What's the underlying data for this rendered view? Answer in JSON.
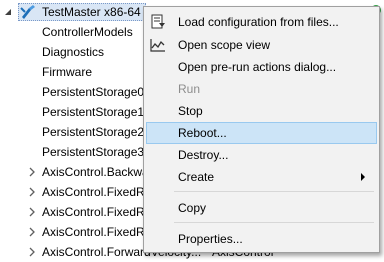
{
  "tree": {
    "root_label": "TestMaster x86-64",
    "items": [
      {
        "label": "ControllerModels",
        "expandable": false
      },
      {
        "label": "Diagnostics",
        "expandable": false
      },
      {
        "label": "Firmware",
        "expandable": false
      },
      {
        "label": "PersistentStorage0",
        "expandable": false
      },
      {
        "label": "PersistentStorage1",
        "expandable": false
      },
      {
        "label": "PersistentStorage2",
        "expandable": false
      },
      {
        "label": "PersistentStorage3",
        "expandable": false
      },
      {
        "label": "AxisControl.Backwa",
        "expandable": true
      },
      {
        "label": "AxisControl.FixedR",
        "expandable": true
      },
      {
        "label": "AxisControl.FixedR",
        "expandable": true
      },
      {
        "label": "AxisControl.FixedR",
        "expandable": true
      },
      {
        "label": "AxisControl.ForwardVelocity...",
        "expandable": true,
        "type": "AxisControl"
      }
    ]
  },
  "context_menu": {
    "items": [
      {
        "label": "Load configuration from files...",
        "icon": "load-config-icon",
        "enabled": true
      },
      {
        "label": "Open scope view",
        "icon": "scope-view-icon",
        "enabled": true
      },
      {
        "label": "Open pre-run actions dialog...",
        "enabled": true
      },
      {
        "label": "Run",
        "enabled": false
      },
      {
        "label": "Stop",
        "enabled": true
      },
      {
        "label": "Reboot...",
        "enabled": true,
        "highlighted": true
      },
      {
        "label": "Destroy...",
        "enabled": true
      },
      {
        "label": "Create",
        "enabled": true,
        "submenu": true
      },
      {
        "label": "Copy",
        "enabled": true
      },
      {
        "label": "Properties...",
        "enabled": true
      }
    ]
  },
  "colors": {
    "highlight": "#cce4f7",
    "highlight_border": "#99c9ef",
    "menu_bg": "#f2f2f2",
    "disabled_text": "#8d8d8d",
    "status_green": "#2ea043"
  }
}
